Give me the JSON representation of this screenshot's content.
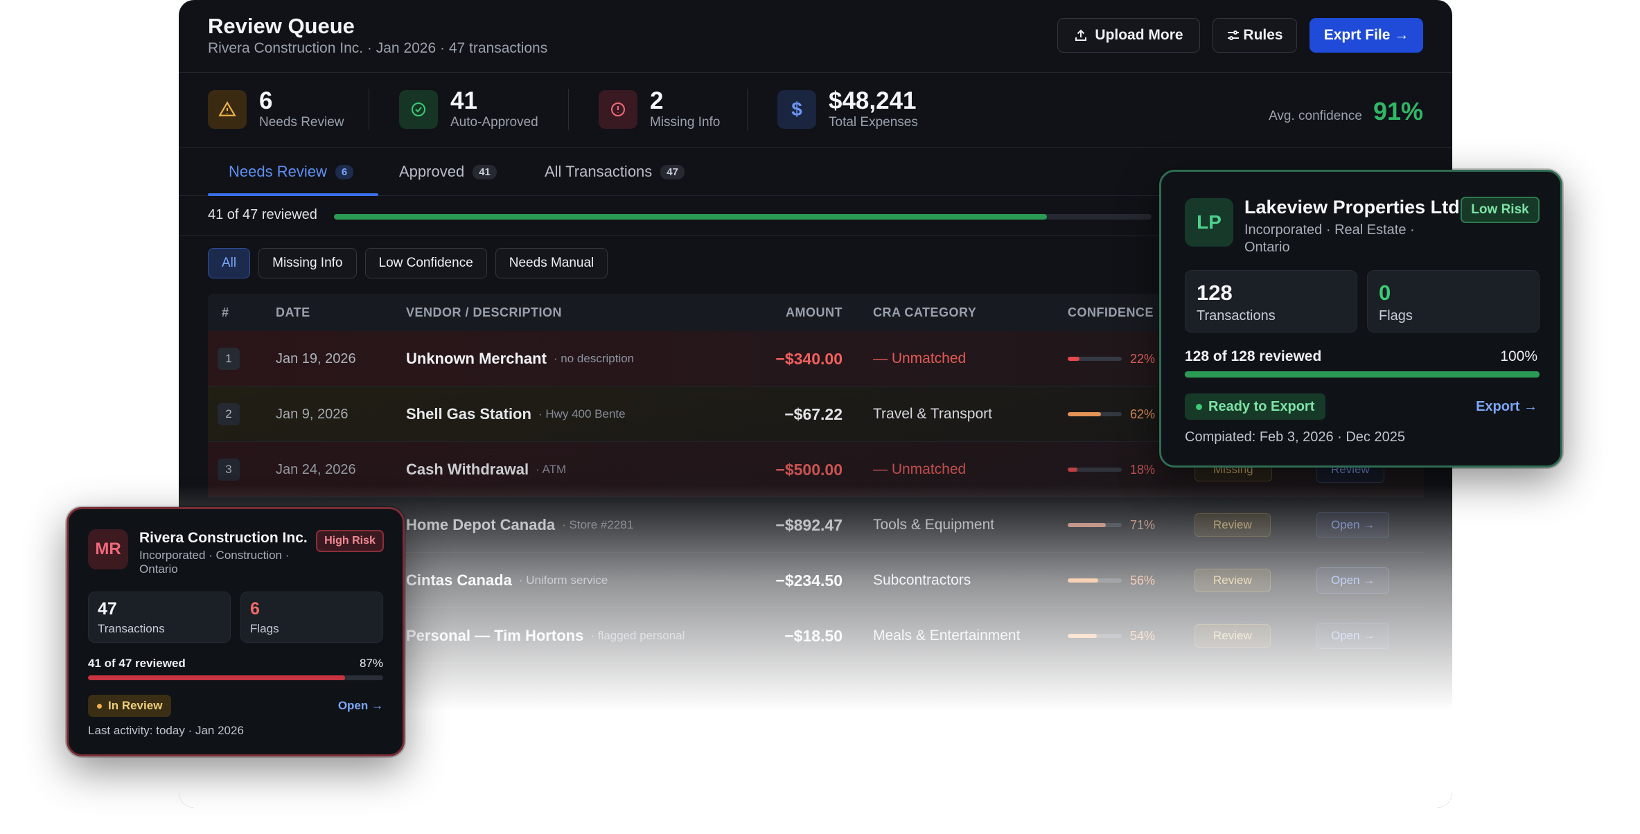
{
  "header": {
    "title": "Review Queue",
    "subtitle": "Rivera Construction Inc. · Jan 2026 · 47 transactions",
    "upload_label": "Upload More",
    "rules_label": "Rules",
    "export_label": "Exprt File →"
  },
  "stats": [
    {
      "value": "6",
      "label": "Needs Review"
    },
    {
      "value": "41",
      "label": "Auto-Approved"
    },
    {
      "value": "2",
      "label": "Missing Info"
    },
    {
      "value": "$48,241",
      "label": "Total Expenses"
    }
  ],
  "avg_confidence": {
    "label": "Avg. confidence",
    "value": "91%"
  },
  "tabs": [
    {
      "label": "Needs Review",
      "count": "6"
    },
    {
      "label": "Approved",
      "count": "41"
    },
    {
      "label": "All Transactions",
      "count": "47"
    }
  ],
  "progress": {
    "text": "41 of 47 reviewed",
    "fraction": 0.872
  },
  "filters": [
    "All",
    "Missing Info",
    "Low Confidence",
    "Needs Manual"
  ],
  "table": {
    "columns": [
      "#",
      "DATE",
      "VENDOR / DESCRIPTION",
      "AMOUNT",
      "CRA CATEGORY",
      "CONFIDENCE"
    ],
    "rows": [
      {
        "num": "1",
        "date": "Jan 19, 2026",
        "vendor": "Unknown Merchant",
        "desc": "· no description",
        "amount": "−$340.00",
        "category": "— Unmatched",
        "confidence": "22%",
        "conf_value": 0.22,
        "status": "",
        "action": ""
      },
      {
        "num": "2",
        "date": "Jan 9, 2026",
        "vendor": "Shell Gas Station",
        "desc": "· Hwy 400 Bente",
        "amount": "−$67.22",
        "category": "Travel & Transport",
        "confidence": "62%",
        "conf_value": 0.62,
        "status": "",
        "action": ""
      },
      {
        "num": "3",
        "date": "Jan 24, 2026",
        "vendor": "Cash Withdrawal",
        "desc": "· ATM",
        "amount": "−$500.00",
        "category": "— Unmatched",
        "confidence": "18%",
        "conf_value": 0.18,
        "status": "Missing",
        "action": "Review"
      },
      {
        "num": "",
        "date": "",
        "vendor": "Home Depot Canada",
        "desc": "· Store #2281",
        "amount": "−$892.47",
        "category": "Tools & Equipment",
        "confidence": "71%",
        "conf_value": 0.71,
        "status": "Review",
        "action": "Open →"
      },
      {
        "num": "",
        "date": "",
        "vendor": "Cintas Canada",
        "desc": "· Uniform service",
        "amount": "−$234.50",
        "category": "Subcontractors",
        "confidence": "56%",
        "conf_value": 0.56,
        "status": "Review",
        "action": "Open →"
      },
      {
        "num": "",
        "date": "",
        "vendor": "Personal — Tim Hortons",
        "desc": "· flagged personal",
        "amount": "−$18.50",
        "category": "Meals & Entertainment",
        "confidence": "54%",
        "conf_value": 0.54,
        "status": "Review",
        "action": "Open →"
      }
    ]
  },
  "card_lakeview": {
    "initials": "LP",
    "name": "Lakeview Properties Ltd.",
    "meta": "Incorporated · Real Estate · Ontario",
    "risk": "Low Risk",
    "transactions_value": "128",
    "transactions_label": "Transactions",
    "flags_value": "0",
    "flags_label": "Flags",
    "progress_label": "128 of 128 reviewed",
    "progress_pct": "100%",
    "progress_fraction": 1.0,
    "status": "Ready to Export",
    "link": "Export →",
    "footer": "Compiated: Feb 3, 2026 · Dec 2025"
  },
  "card_rivera": {
    "initials": "MR",
    "name": "Rivera Construction Inc.",
    "meta": "Incorporated · Construction · Ontario",
    "risk": "High Risk",
    "transactions_value": "47",
    "transactions_label": "Transactions",
    "flags_value": "6",
    "flags_label": "Flags",
    "progress_label": "41 of 47 reviewed",
    "progress_pct": "87%",
    "progress_fraction": 0.87,
    "status": "In Review",
    "link": "Open →",
    "footer": "Last activity: today · Jan 2026"
  },
  "colors": {
    "accent": "#1f4bd8",
    "success": "#2fb766",
    "danger": "#f0605d",
    "warning": "#d8b46a"
  },
  "icons": [
    "upload-icon",
    "sliders-icon",
    "warning-icon",
    "check-circle-icon",
    "info-circle-icon",
    "dollar-icon"
  ]
}
